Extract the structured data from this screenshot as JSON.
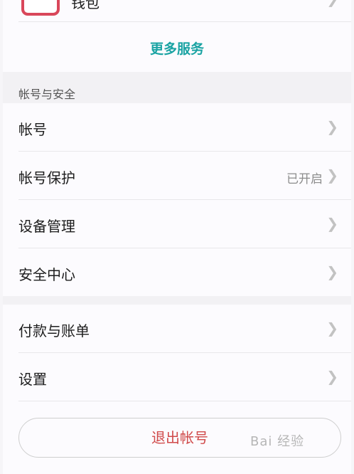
{
  "wallet": {
    "label": "钱包"
  },
  "more_services": {
    "label": "更多服务"
  },
  "account_security": {
    "header": "帐号与安全",
    "items": [
      {
        "label": "帐号",
        "value": ""
      },
      {
        "label": "帐号保护",
        "value": "已开启"
      },
      {
        "label": "设备管理",
        "value": ""
      },
      {
        "label": "安全中心",
        "value": ""
      }
    ]
  },
  "other": {
    "items": [
      {
        "label": "付款与账单"
      },
      {
        "label": "设置"
      }
    ]
  },
  "logout": {
    "label": "退出帐号"
  },
  "watermark": {
    "text": "Bai 经验"
  },
  "colors": {
    "accent": "#1aa3a3",
    "danger": "#d04a4a",
    "wallet_icon": "#d9475a"
  },
  "icons": {
    "chevron": "chevron-right-icon",
    "wallet": "wallet-icon"
  }
}
